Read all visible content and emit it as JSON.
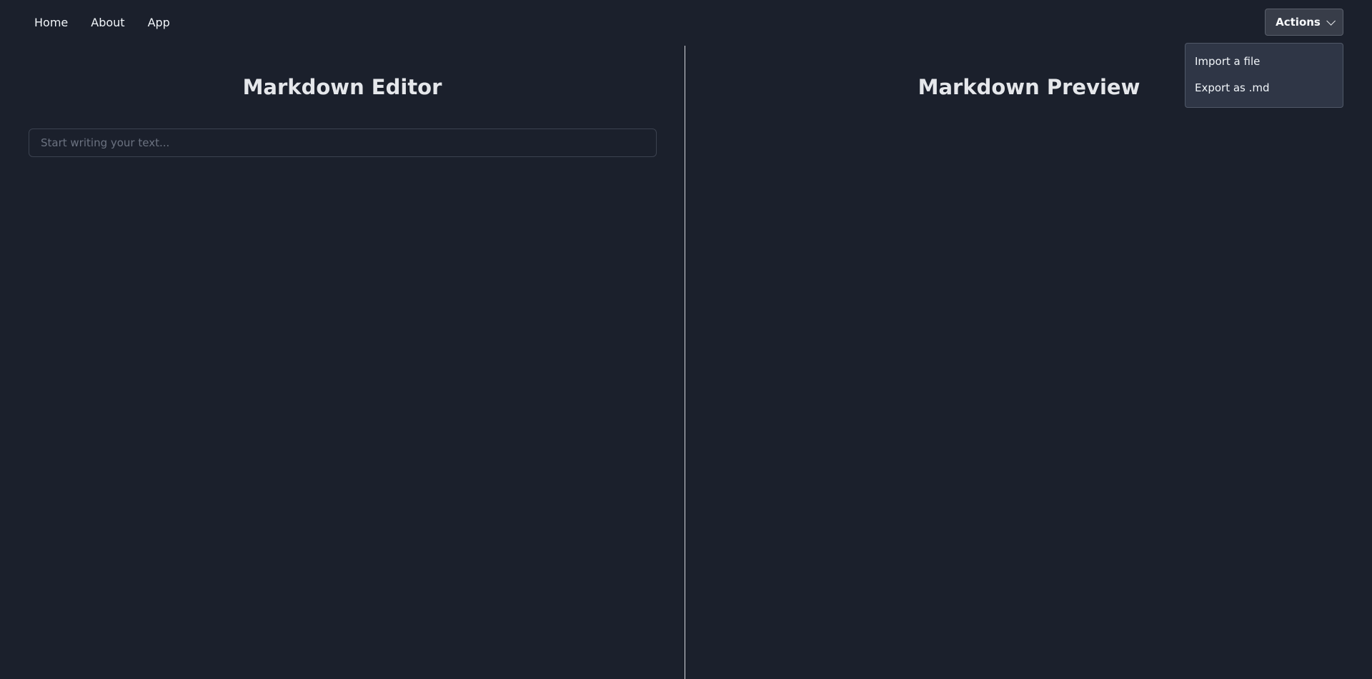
{
  "nav": {
    "links": [
      "Home",
      "About",
      "App"
    ]
  },
  "actions": {
    "label": "Actions",
    "menu_items": [
      "Import a file",
      "Export as .md"
    ]
  },
  "editor": {
    "title": "Markdown Editor",
    "placeholder": "Start writing your text...",
    "value": ""
  },
  "preview": {
    "title": "Markdown Preview"
  },
  "colors": {
    "background": "#1b202c",
    "menu_background": "#2f3646",
    "button_background": "#383d49",
    "divider": "#d6d9de"
  }
}
